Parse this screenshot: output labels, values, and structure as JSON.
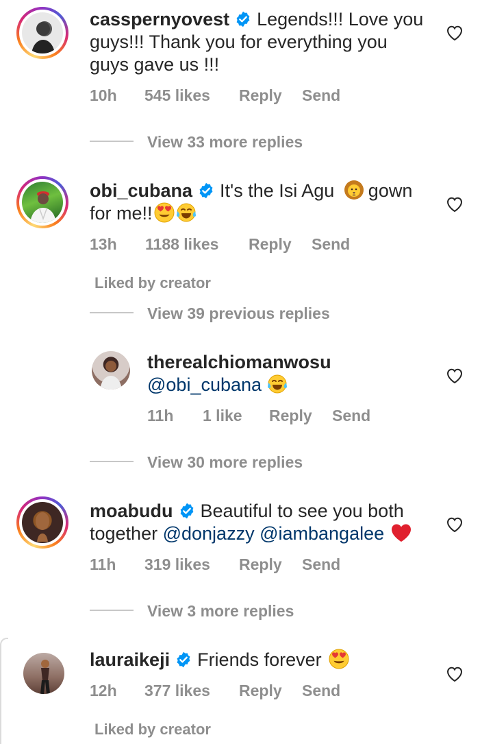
{
  "comments": [
    {
      "username": "casspernyovest",
      "text_line1": "Legends!!! Love you",
      "text_line2": "guys!!! Thank you for everything you",
      "text_line3": "guys gave us !!!",
      "time": "10h",
      "likes": "545 likes",
      "reply": "Reply",
      "send": "Send",
      "view_replies": "View 33 more replies"
    },
    {
      "username": "obi_cubana",
      "text_line1": "It's the Isi Agu",
      "text_line1_after": "gown",
      "text_line2": "for me!!",
      "time": "13h",
      "likes": "1188 likes",
      "reply": "Reply",
      "send": "Send",
      "liked_by": "Liked by creator",
      "view_replies": "View 39 previous replies"
    },
    {
      "username": "therealchiomanwosu",
      "mention": "@obi_cubana",
      "time": "11h",
      "likes": "1 like",
      "reply": "Reply",
      "send": "Send",
      "view_replies": "View 30 more replies"
    },
    {
      "username": "moabudu",
      "text_line1": "Beautiful to see you both",
      "text_line2_prefix": "together",
      "mention1": "@donjazzy",
      "mention2": "@iambangalee",
      "time": "11h",
      "likes": "319 likes",
      "reply": "Reply",
      "send": "Send",
      "view_replies": "View 3 more replies"
    },
    {
      "username": "lauraikeji",
      "text_line1": "Friends forever",
      "time": "12h",
      "likes": "377 likes",
      "reply": "Reply",
      "send": "Send",
      "liked_by": "Liked by creator"
    }
  ],
  "colors": {
    "text": "#262626",
    "meta": "#8e8e8e",
    "mention": "#00376b",
    "verified": "#0095f6"
  }
}
